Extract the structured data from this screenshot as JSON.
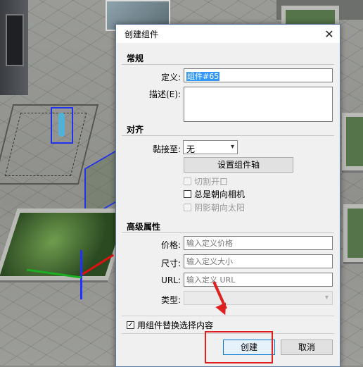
{
  "dialog": {
    "title": "创建组件",
    "close_glyph": "✕",
    "general": {
      "heading": "常规",
      "definition_label": "定义:",
      "definition_value": "组件#65",
      "description_label": "描述(E):",
      "description_value": ""
    },
    "alignment": {
      "heading": "对齐",
      "glue_label": "黏接至:",
      "glue_value": "无",
      "set_axes_button": "设置组件轴",
      "cut_opening_label": "切割开口",
      "always_face_camera_label": "总是朝向相机",
      "shadows_face_sun_label": "阴影朝向太阳",
      "cut_opening_checked": false,
      "always_face_camera_checked": false,
      "shadows_face_sun_checked": false
    },
    "advanced": {
      "heading": "高级属性",
      "price_label": "价格:",
      "price_placeholder": "输入定义价格",
      "size_label": "尺寸:",
      "size_placeholder": "输入定义大小",
      "url_label": "URL:",
      "url_placeholder": "输入定义 URL",
      "type_label": "类型:",
      "type_value": ""
    },
    "replace_selection_label": "用组件替换选择内容",
    "replace_selection_checked": true,
    "create_button": "创建",
    "cancel_button": "取消"
  },
  "icons": {
    "dropdown": "▾",
    "check": "✓"
  },
  "colors": {
    "selection": "#3399ff",
    "annotation_red": "#e02020",
    "axis_blue": "#2030ff",
    "axis_green": "#18b020",
    "axis_red": "#e01010"
  }
}
